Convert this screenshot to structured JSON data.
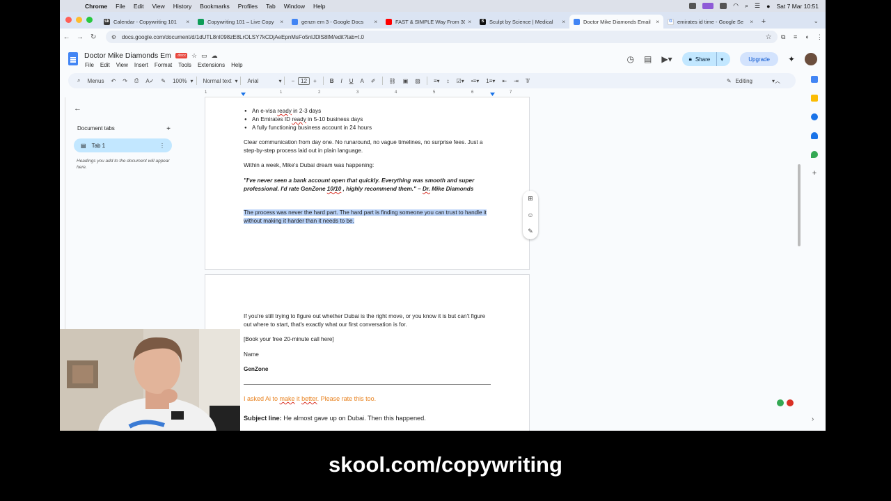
{
  "mac_menubar": {
    "items": [
      "Chrome",
      "File",
      "Edit",
      "View",
      "History",
      "Bookmarks",
      "Profiles",
      "Tab",
      "Window",
      "Help"
    ],
    "clock": "Sat 7 Mar 10:51"
  },
  "browser": {
    "tabs": [
      {
        "title": "Calendar - Copywriting 101",
        "favicon": "sk",
        "color": "#3a3a3a"
      },
      {
        "title": "Copywriting 101 – Live Copy",
        "favicon": "",
        "color": "#0f9d58"
      },
      {
        "title": "genzn em 3 - Google Docs",
        "favicon": "",
        "color": "#4285f4"
      },
      {
        "title": "FAST & SIMPLE Way From 30",
        "favicon": "",
        "color": "#ff0000"
      },
      {
        "title": "Sculpt by Science | Medical",
        "favicon": "S",
        "color": "#111111"
      },
      {
        "title": "Doctor Mike Diamonds Email",
        "favicon": "",
        "color": "#4285f4"
      },
      {
        "title": "emirates id time - Google Se",
        "favicon": "G",
        "color": "#ffffff"
      }
    ],
    "active_tab": 5,
    "url": "docs.google.com/document/d/1dUTL8nI098zE8LrOLSY7kCDjAeEpnMsFo5nlJDlS8lM/edit?tab=t.0"
  },
  "docs": {
    "title": "Doctor Mike Diamonds Em",
    "menus": [
      "File",
      "Edit",
      "View",
      "Insert",
      "Format",
      "Tools",
      "Extensions",
      "Help"
    ],
    "share_label": "Share",
    "upgrade_label": "Upgrade",
    "toolbar": {
      "menus_label": "Menus",
      "zoom": "100%",
      "style": "Normal text",
      "font": "Arial",
      "font_size": "12",
      "mode": "Editing"
    },
    "ruler_numbers": [
      "1",
      "1",
      "2",
      "3",
      "4",
      "5",
      "6",
      "7"
    ]
  },
  "outline": {
    "header": "Document tabs",
    "tab_name": "Tab 1",
    "hint": "Headings you add to the document will appear here."
  },
  "document": {
    "bullets": [
      "An e-visa ready in 2-3 days",
      "An Emirates ID ready in 5-10 business days",
      "A fully functioning business account in 24 hours"
    ],
    "p_clear": "Clear communication from day one. No runaround, no vague timelines, no surprise fees. Just a step-by-step process laid out in plain language.",
    "p_week": "Within a week, Mike's Dubai dream was happening:",
    "quote": "\"I've never seen a bank account open that quickly. Everything was smooth and super professional. I'd rate GenZone 10/10 , highly recommend them.\" – Dr. Mike Diamonds",
    "highlighted": "The process was never the hard part. The hard part is finding someone you can trust to handle it without making it harder than it needs to be.",
    "p_still": "If you're still trying to figure out whether Dubai is the right move, or you know it is but can't figure out where to start,  that's exactly what our first conversation is for.",
    "cta": "[Book your free 20-minute call here]",
    "sign_name": "Name",
    "sign_company": "GenZone",
    "ai_note": "I asked Ai to make it better. Please rate this too.",
    "subject_label": "Subject line:",
    "subject_text": "He almost gave up on Dubai. Then this happened."
  },
  "caption": "skool.com/copywriting"
}
